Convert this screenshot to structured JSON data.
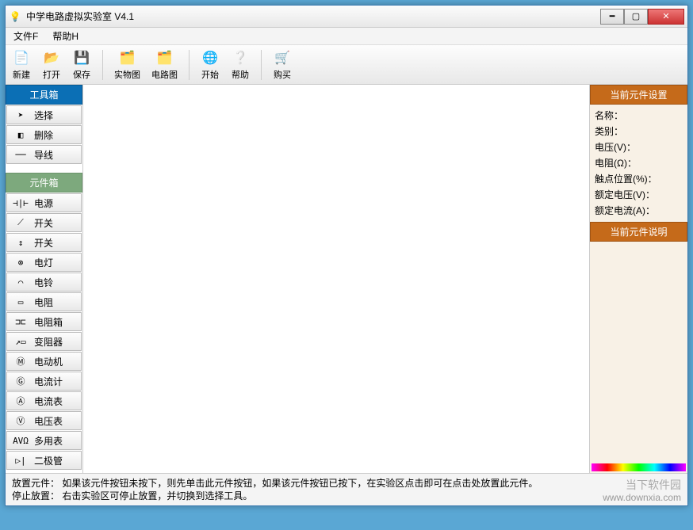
{
  "window": {
    "title": "中学电路虚拟实验室 V4.1"
  },
  "menu": {
    "file": "文件F",
    "help": "帮助H"
  },
  "toolbar": {
    "new": "新建",
    "open": "打开",
    "save": "保存",
    "real": "实物图",
    "schem": "电路图",
    "start": "开始",
    "helpbtn": "帮助",
    "buy": "购买"
  },
  "toolbox": {
    "header": "工具箱",
    "select": "选择",
    "delete": "删除",
    "wire": "导线"
  },
  "partbox": {
    "header": "元件箱",
    "items": [
      {
        "sym": "⊣∣⊢",
        "label": "电源"
      },
      {
        "sym": "⟋",
        "label": "开关"
      },
      {
        "sym": "↕",
        "label": "开关"
      },
      {
        "sym": "⊗",
        "label": "电灯"
      },
      {
        "sym": "⌒",
        "label": "电铃"
      },
      {
        "sym": "▭",
        "label": "电阻"
      },
      {
        "sym": "⊐⊏",
        "label": "电阻箱"
      },
      {
        "sym": "↗▭",
        "label": "变阻器"
      },
      {
        "sym": "Ⓜ",
        "label": "电动机"
      },
      {
        "sym": "Ⓖ",
        "label": "电流计"
      },
      {
        "sym": "Ⓐ",
        "label": "电流表"
      },
      {
        "sym": "Ⓥ",
        "label": "电压表"
      },
      {
        "sym": "AVΩ",
        "label": "多用表"
      },
      {
        "sym": "▷|",
        "label": "二极管"
      }
    ]
  },
  "right": {
    "settings_hdr": "当前元件设置",
    "desc_hdr": "当前元件说明",
    "name": "名称：",
    "type": "类别：",
    "voltage": "电压(V)：",
    "resistance": "电阻(Ω)：",
    "contact": "触点位置(%)：",
    "rated_v": "额定电压(V)：",
    "rated_a": "额定电流(A)："
  },
  "status": {
    "line1": "放置元件：  如果该元件按钮未按下，则先单击此元件按钮，如果该元件按钮已按下，在实验区点击即可在点击处放置此元件。",
    "line2": "停止放置：  右击实验区可停止放置，并切换到选择工具。"
  },
  "watermark": {
    "name": "当下软件园",
    "url": "www.downxia.com"
  }
}
